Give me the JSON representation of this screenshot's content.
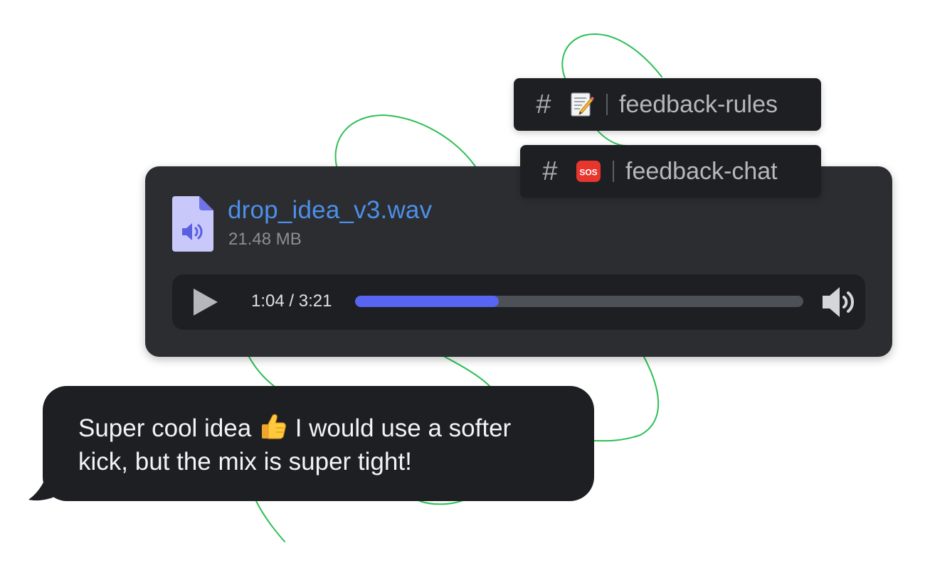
{
  "channels": [
    {
      "hash": "#",
      "emoji": "memo-emoji",
      "name": "feedback-rules"
    },
    {
      "hash": "#",
      "emoji": "sos-emoji",
      "name": "feedback-chat",
      "emoji_label": "SOS"
    }
  ],
  "audio": {
    "file_name": "drop_idea_v3.wav",
    "file_size": "21.48 MB",
    "time": "1:04 / 3:21",
    "progress_fraction": 0.32,
    "play_icon": "play-icon",
    "volume_icon": "volume-icon",
    "file_icon": "audio-file-icon"
  },
  "message": {
    "text_before": "Super cool idea",
    "emoji": "thumbs-up-emoji",
    "text_after": "I would use a softer",
    "line2": "kick, but the mix is super tight!"
  },
  "colors": {
    "card_bg": "#2b2d31",
    "player_bg": "#1e1f22",
    "link": "#4d8fe8",
    "progress_fill": "#5865f2",
    "doodle": "#2dbf55"
  }
}
